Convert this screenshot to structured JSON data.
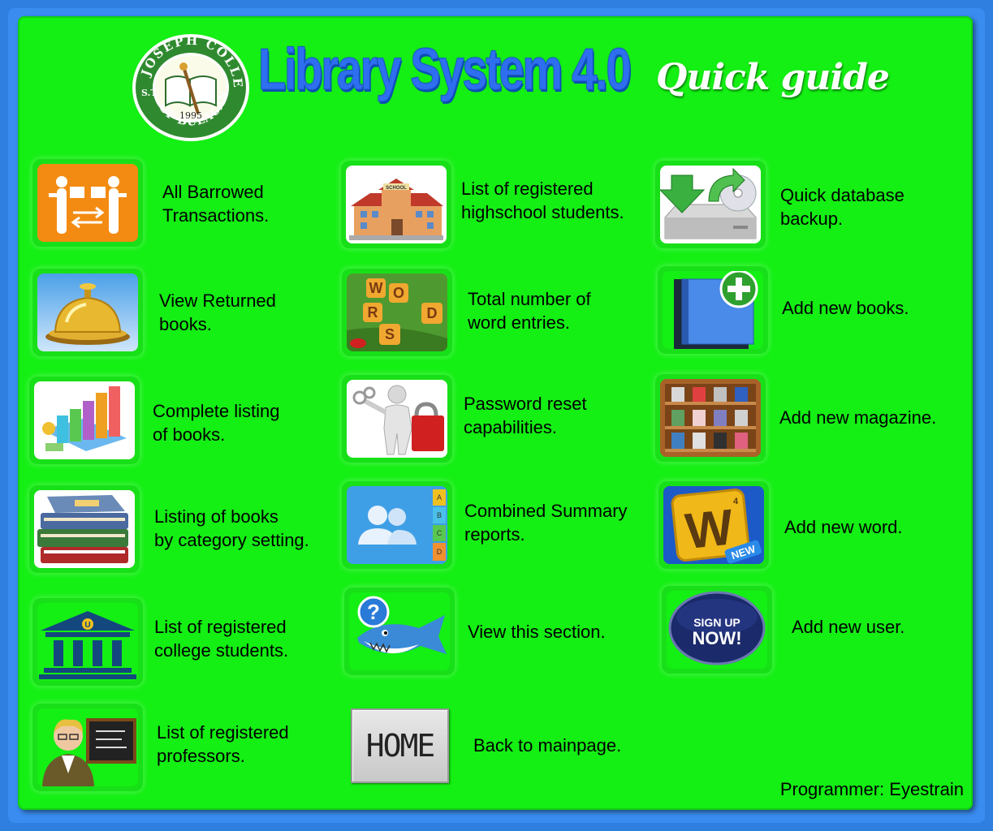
{
  "header": {
    "logo_text_top": "JOSEPH COLLEGE",
    "logo_text_bottom": "OF BULACAN",
    "logo_prefix": "S.T.",
    "logo_year": "1995",
    "title": "Library System 4.0",
    "subtitle": "Quick guide"
  },
  "items": [
    {
      "label": "All Barrowed\nTransactions.",
      "icon": "borrow-transactions-icon"
    },
    {
      "label": "View Returned\nbooks.",
      "icon": "service-bell-icon"
    },
    {
      "label": "Complete listing\nof books.",
      "icon": "bar-chart-icon"
    },
    {
      "label": "Listing of books\nby category setting.",
      "icon": "book-stack-icon"
    },
    {
      "label": "List of registered\ncollege students.",
      "icon": "university-icon"
    },
    {
      "label": "List of registered\nprofessors.",
      "icon": "professor-icon"
    },
    {
      "label": "List of registered\nhighschool students.",
      "icon": "school-building-icon"
    },
    {
      "label": "Total number of\nword entries.",
      "icon": "words-game-icon"
    },
    {
      "label": "Password reset\ncapabilities.",
      "icon": "keys-lock-icon"
    },
    {
      "label": "Combined Summary\nreports.",
      "icon": "contacts-icon"
    },
    {
      "label": "View this section.",
      "icon": "help-shark-icon"
    },
    {
      "label": "Back to mainpage.",
      "icon": "home-button"
    },
    {
      "label": "Quick database\nbackup.",
      "icon": "database-backup-icon"
    },
    {
      "label": "Add new books.",
      "icon": "add-book-icon"
    },
    {
      "label": "Add new magazine.",
      "icon": "magazine-shelf-icon"
    },
    {
      "label": "Add new word.",
      "icon": "words-new-icon"
    },
    {
      "label": "Add new user.",
      "icon": "sign-up-icon"
    }
  ],
  "icon_text": {
    "school_sign": "SCHOOL",
    "words_letters": [
      "W",
      "O",
      "R",
      "D",
      "S"
    ],
    "contacts_tabs": [
      "A",
      "B",
      "C",
      "D"
    ],
    "university_letter": "U",
    "words_new_letter": "W",
    "words_new_number": "4",
    "words_new_badge": "NEW",
    "signup_line1": "SIGN UP",
    "signup_line2": "NOW!",
    "home_label": "HOME"
  },
  "footer": {
    "credit": "Programmer: Eyestrain"
  }
}
